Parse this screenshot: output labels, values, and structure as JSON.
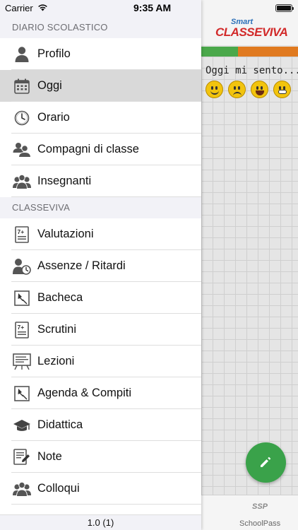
{
  "status_bar": {
    "carrier": "Carrier",
    "time": "9:35 AM"
  },
  "sections": [
    {
      "title": "DIARIO SCOLASTICO",
      "items": [
        {
          "label": "Profilo",
          "icon": "person-icon",
          "selected": false
        },
        {
          "label": "Oggi",
          "icon": "calendar-icon",
          "selected": true
        },
        {
          "label": "Orario",
          "icon": "clock-icon",
          "selected": false
        },
        {
          "label": "Compagni di classe",
          "icon": "classmates-icon",
          "selected": false
        },
        {
          "label": "Insegnanti",
          "icon": "teachers-icon",
          "selected": false
        }
      ]
    },
    {
      "title": "CLASSEVIVA",
      "items": [
        {
          "label": "Valutazioni",
          "icon": "grade-icon",
          "selected": false
        },
        {
          "label": "Assenze / Ritardi",
          "icon": "absence-clock-icon",
          "selected": false
        },
        {
          "label": "Bacheca",
          "icon": "pin-board-icon",
          "selected": false
        },
        {
          "label": "Scrutini",
          "icon": "report-card-icon",
          "selected": false
        },
        {
          "label": "Lezioni",
          "icon": "blackboard-icon",
          "selected": false
        },
        {
          "label": "Agenda & Compiti",
          "icon": "pin-agenda-icon",
          "selected": false
        },
        {
          "label": "Didattica",
          "icon": "graduation-cap-icon",
          "selected": false
        },
        {
          "label": "Note",
          "icon": "note-edit-icon",
          "selected": false
        },
        {
          "label": "Colloqui",
          "icon": "meeting-icon",
          "selected": false
        }
      ]
    }
  ],
  "footer": {
    "version": "1.0 (1)"
  },
  "background_app": {
    "logo_small": "Smart",
    "logo_main": "CLASSEVIVA",
    "mood_prompt": "Oggi mi sento...",
    "tab_label": "SchoolPass",
    "tab_mark": "SSP",
    "colors": {
      "accent_green": "#3aa24a",
      "bar_orange": "#e07a20",
      "logo_red": "#d22a2a"
    }
  }
}
